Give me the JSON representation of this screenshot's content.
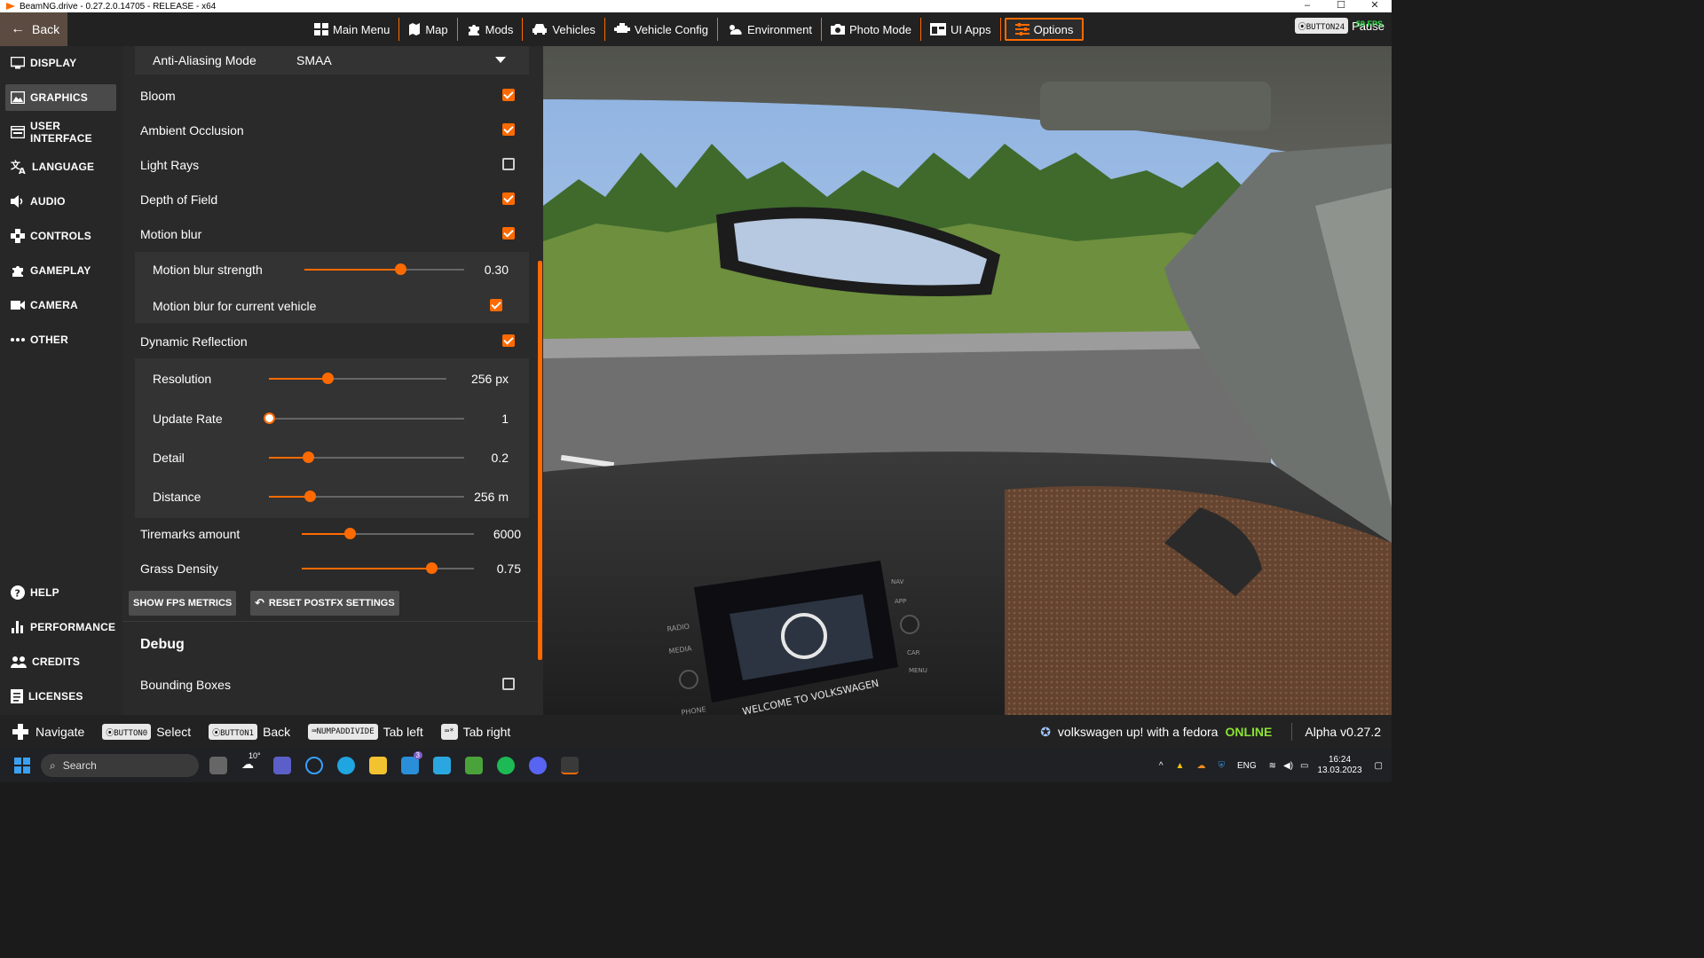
{
  "window": {
    "title": "BeamNG.drive - 0.27.2.0.14705 - RELEASE - x64",
    "controls": [
      "–",
      "☐",
      "✕"
    ]
  },
  "topbar": {
    "back_label": "Back",
    "nav": [
      {
        "label": "Main Menu",
        "icon": "main-menu-icon"
      },
      {
        "label": "Map",
        "icon": "map-icon"
      },
      {
        "label": "Mods",
        "icon": "puzzle-icon"
      },
      {
        "label": "Vehicles",
        "icon": "car-icon"
      },
      {
        "label": "Vehicle Config",
        "icon": "vehicle-config-icon"
      },
      {
        "label": "Environment",
        "icon": "weather-icon"
      },
      {
        "label": "Photo Mode",
        "icon": "camera-icon"
      },
      {
        "label": "UI Apps",
        "icon": "ui-apps-icon"
      },
      {
        "label": "Options",
        "icon": "sliders-icon",
        "active": true
      }
    ],
    "pause_key": "⦿BUTTON24",
    "pause_label": "Pause",
    "fps": "59 FPS"
  },
  "sidebar": {
    "items": [
      {
        "label": "DISPLAY",
        "icon": "monitor-icon"
      },
      {
        "label": "GRAPHICS",
        "icon": "image-icon",
        "active": true
      },
      {
        "label": "USER INTERFACE",
        "icon": "ui-icon"
      },
      {
        "label": "LANGUAGE",
        "icon": "translate-icon"
      },
      {
        "label": "AUDIO",
        "icon": "speaker-icon"
      },
      {
        "label": "CONTROLS",
        "icon": "gamepad-icon"
      },
      {
        "label": "GAMEPLAY",
        "icon": "puzzle-icon"
      },
      {
        "label": "CAMERA",
        "icon": "video-camera-icon"
      },
      {
        "label": "OTHER",
        "icon": "more-icon"
      }
    ],
    "bottom_items": [
      {
        "label": "HELP",
        "icon": "help-icon"
      },
      {
        "label": "PERFORMANCE",
        "icon": "bar-chart-icon"
      },
      {
        "label": "CREDITS",
        "icon": "people-icon"
      },
      {
        "label": "LICENSES",
        "icon": "document-icon"
      }
    ]
  },
  "settings": {
    "aa_label": "Anti-Aliasing Mode",
    "aa_value": "SMAA",
    "bloom": {
      "label": "Bloom",
      "checked": true
    },
    "ao": {
      "label": "Ambient Occlusion",
      "checked": true
    },
    "light_rays": {
      "label": "Light Rays",
      "checked": false
    },
    "dof": {
      "label": "Depth of Field",
      "checked": true
    },
    "motion_blur": {
      "label": "Motion blur",
      "checked": true
    },
    "mb_strength": {
      "label": "Motion blur strength",
      "value": "0.30",
      "fraction": 0.6
    },
    "mb_vehicle": {
      "label": "Motion blur for current vehicle",
      "checked": true
    },
    "dyn_reflection": {
      "label": "Dynamic Reflection",
      "checked": true
    },
    "resolution": {
      "label": "Resolution",
      "value": "256 px",
      "fraction": 0.33
    },
    "update_rate": {
      "label": "Update Rate",
      "value": "1",
      "fraction": 0.0
    },
    "detail": {
      "label": "Detail",
      "value": "0.2",
      "fraction": 0.2
    },
    "distance": {
      "label": "Distance",
      "value": "256 m",
      "fraction": 0.21
    },
    "tiremarks": {
      "label": "Tiremarks amount",
      "value": "6000",
      "fraction": 0.28
    },
    "grass": {
      "label": "Grass Density",
      "value": "0.75",
      "fraction": 0.75
    },
    "show_fps_btn": "SHOW FPS METRICS",
    "reset_btn": "RESET POSTFX SETTINGS",
    "debug_heading": "Debug",
    "bounding_boxes": {
      "label": "Bounding Boxes",
      "checked": false
    }
  },
  "dashboard": {
    "screen_text": "WELCOME TO VOLKSWAGEN",
    "radio_label": "RADIO",
    "media_label": "MEDIA",
    "phone_label": "PHONE",
    "nav_label": "NAV",
    "app_label": "APP",
    "car_label": "CAR",
    "menu_label": "MENU"
  },
  "hints": [
    {
      "key": "",
      "label": "Navigate",
      "icon": "dpad-icon"
    },
    {
      "key": "⦿BUTTON0",
      "label": "Select"
    },
    {
      "key": "⦿BUTTON1",
      "label": "Back"
    },
    {
      "key": "⌨NUMPADDIVIDE",
      "label": "Tab left"
    },
    {
      "key": "⌨*",
      "label": "Tab right"
    }
  ],
  "status": {
    "vehicle": "volkswagen up! with a fedora",
    "online": "ONLINE",
    "version": "Alpha v0.27.2"
  },
  "taskbar": {
    "search_placeholder": "Search",
    "weather_temp": "10°",
    "lang": "ENG",
    "time": "16:24",
    "date": "13.03.2023",
    "mail_badge": "3"
  }
}
